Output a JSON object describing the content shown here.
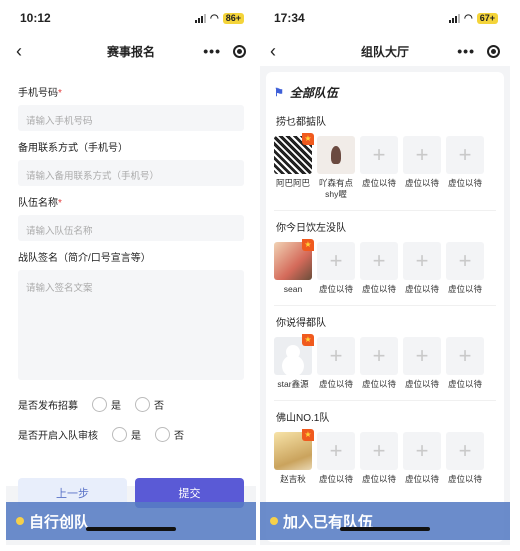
{
  "left": {
    "status": {
      "time": "10:12",
      "battery": "86+"
    },
    "nav": {
      "title": "赛事报名"
    },
    "form": {
      "phone_label": "手机号码",
      "phone_placeholder": "请输入手机号码",
      "backup_label": "备用联系方式（手机号）",
      "backup_placeholder": "请输入备用联系方式（手机号）",
      "team_label": "队伍名称",
      "team_placeholder": "请输入队伍名称",
      "sign_label": "战队签名（简介/口号宣言等）",
      "sign_placeholder": "请输入签名文案",
      "recruit_label": "是否发布招募",
      "audit_label": "是否开启入队审核",
      "yes": "是",
      "no": "否",
      "required_mark": "*"
    },
    "buttons": {
      "prev": "上一步",
      "submit": "提交"
    },
    "caption": "自行创队"
  },
  "right": {
    "status": {
      "time": "17:34",
      "battery": "67+"
    },
    "nav": {
      "title": "组队大厅"
    },
    "section_title": "全部队伍",
    "slot_symbol": "+",
    "leader_mark": "★",
    "teams": [
      {
        "name": "捞乜都掂队",
        "members": [
          "阿巴阿巴",
          "吖森有点shy喔",
          "虚位以待",
          "虚位以待",
          "虚位以待"
        ]
      },
      {
        "name": "你今日饮左没队",
        "members": [
          "sean",
          "虚位以待",
          "虚位以待",
          "虚位以待",
          "虚位以待"
        ]
      },
      {
        "name": "你说得都队",
        "members": [
          "star鑫源",
          "虚位以待",
          "虚位以待",
          "虚位以待",
          "虚位以待"
        ]
      },
      {
        "name": "佛山NO.1队",
        "members": [
          "赵吉秋",
          "虚位以待",
          "虚位以待",
          "虚位以待",
          "虚位以待"
        ]
      }
    ],
    "caption": "加入已有队伍"
  }
}
